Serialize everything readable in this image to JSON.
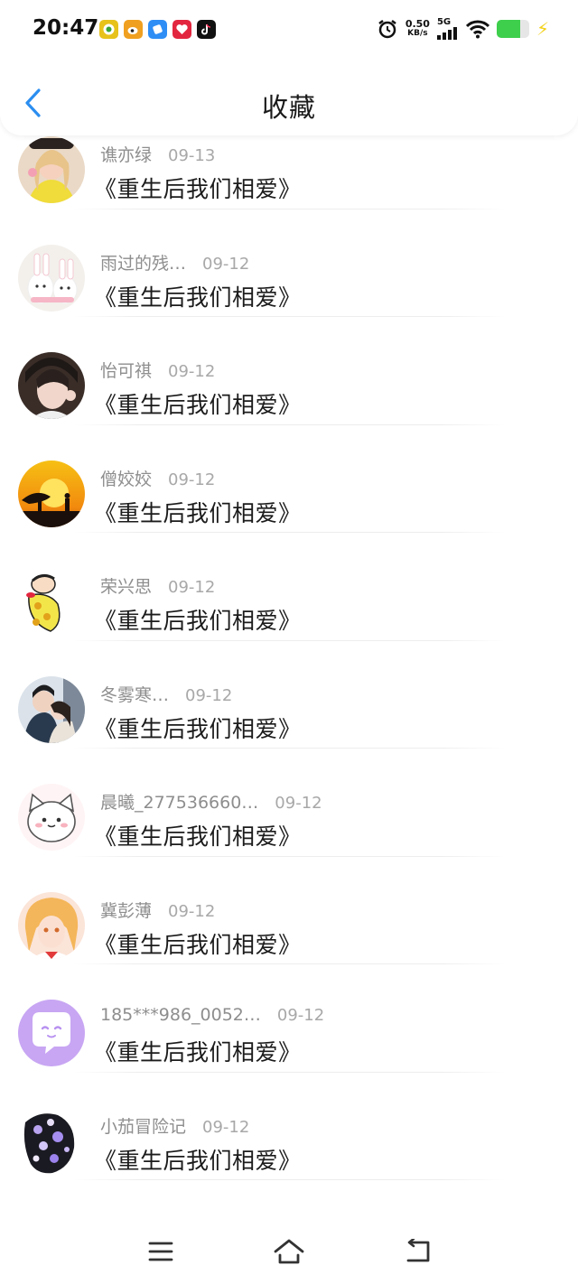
{
  "status_bar": {
    "time": "20:47",
    "app_icons": [
      {
        "name": "music-app-icon",
        "color": "#e7c21b"
      },
      {
        "name": "weibo-app-icon",
        "color": "#f0a020"
      },
      {
        "name": "browser-app-icon",
        "color": "#2f8ef5"
      },
      {
        "name": "heart-app-icon",
        "color": "#e3263f"
      },
      {
        "name": "tiktok-app-icon",
        "color": "#111111"
      }
    ],
    "net_speed_value": "0.50",
    "net_speed_unit": "KB/s",
    "network_type": "5G",
    "battery_level": 0.72
  },
  "header": {
    "title": "收藏"
  },
  "favorites": [
    {
      "username": "谯亦绿",
      "date": "09-13",
      "title": "《重生后我们相爱》"
    },
    {
      "username": "雨过的残…",
      "date": "09-12",
      "title": "《重生后我们相爱》"
    },
    {
      "username": "怡可祺",
      "date": "09-12",
      "title": "《重生后我们相爱》"
    },
    {
      "username": "僧姣姣",
      "date": "09-12",
      "title": "《重生后我们相爱》"
    },
    {
      "username": "荣兴思",
      "date": "09-12",
      "title": "《重生后我们相爱》"
    },
    {
      "username": "冬雾寒…",
      "date": "09-12",
      "title": "《重生后我们相爱》"
    },
    {
      "username": "晨曦_277536660…",
      "date": "09-12",
      "title": "《重生后我们相爱》"
    },
    {
      "username": "冀彭薄",
      "date": "09-12",
      "title": "《重生后我们相爱》"
    },
    {
      "username": "185***986_0052…",
      "date": "09-12",
      "title": "《重生后我们相爱》"
    },
    {
      "username": "小茄冒险记",
      "date": "09-12",
      "title": "《重生后我们相爱》"
    }
  ],
  "colors": {
    "accent": "#2b8ef0",
    "battery": "#3ecf4c"
  }
}
